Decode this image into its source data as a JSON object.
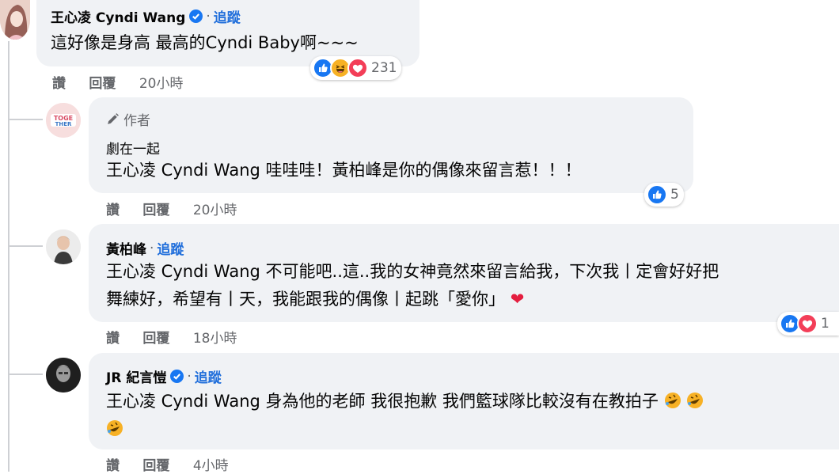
{
  "comments": [
    {
      "author": "王心凌 Cyndi Wang",
      "follow": "追蹤",
      "text": "這好像是身高 最高的Cyndi Baby啊~~~",
      "actions": {
        "like": "讚",
        "reply": "回覆",
        "time": "20小時"
      },
      "reactions_count": "231"
    },
    {
      "author_tag": "作者",
      "subname": "劇在一起",
      "text": "王心凌 Cyndi Wang 哇哇哇！黃柏峰是你的偶像來留言惹！！！",
      "actions": {
        "like": "讚",
        "reply": "回覆",
        "time": "20小時"
      },
      "reactions_count": "5"
    },
    {
      "author": "黃柏峰",
      "follow": "追蹤",
      "text_line1": "王心凌 Cyndi Wang 不可能吧..這..我的女神竟然來留言給我，下次我丨定會好好把",
      "text_line2": "舞練好，希望有丨天，我能跟我的偶像丨起跳「愛你」",
      "actions": {
        "like": "讚",
        "reply": "回覆",
        "time": "18小時"
      },
      "reactions_count": "1"
    },
    {
      "author": "JR 紀言愷",
      "follow": "追蹤",
      "text": "王心凌 Cyndi Wang 身為他的老師 我很抱歉 我們籃球隊比較沒有在教拍子",
      "actions": {
        "like": "讚",
        "reply": "回覆",
        "time": "4小時"
      }
    }
  ],
  "icons": {
    "verified": "verified-badge-icon",
    "like": "like-reaction-icon",
    "haha": "haha-reaction-icon",
    "love": "love-reaction-icon",
    "pencil": "pencil-icon",
    "laugh_emoji": "rolling-laughing-emoji",
    "heart_emoji": "red-heart-emoji"
  },
  "colors": {
    "bubble": "#f0f2f5",
    "link": "#216fdb",
    "like": "#1877f2",
    "love": "#f33e58",
    "haha": "#f7b125"
  }
}
